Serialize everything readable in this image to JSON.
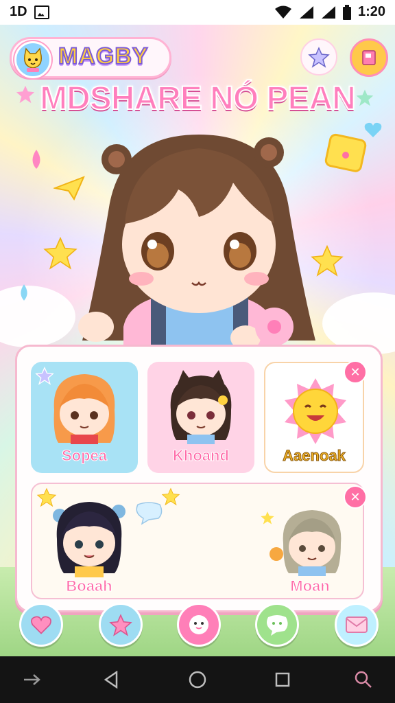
{
  "status_bar": {
    "left_text": "1D",
    "time": "1:20"
  },
  "header": {
    "brand_name": "MAGBY",
    "title": "MDSHARE NÓ PEAN",
    "buttons": [
      {
        "name": "favorites-button",
        "icon": "star-icon"
      },
      {
        "name": "notebook-button",
        "icon": "book-icon"
      }
    ]
  },
  "cards": [
    {
      "name": "Sopea",
      "bg": "#a8e2f5",
      "label_color": "#ff6aa8"
    },
    {
      "name": "Khoand",
      "bg": "#ffd3e6",
      "label_color": "#ff6aa8"
    },
    {
      "name": "Aaenoak",
      "bg": "#ffffff",
      "label_color": "#f2b425"
    },
    {
      "name": "Boaah",
      "bg": "#fff6e4",
      "label_color": "#ff6aa8"
    },
    {
      "name": "Moan",
      "bg": "#fff6e4",
      "label_color": "#ff6aa8"
    }
  ],
  "bottom_nav": [
    {
      "icon": "heart-icon",
      "color": "#9edcf2"
    },
    {
      "icon": "star-icon",
      "color": "#9edcf2"
    },
    {
      "icon": "face-icon",
      "color": "#ff7fb8"
    },
    {
      "icon": "chat-bubble-icon",
      "color": "#9fe28c"
    },
    {
      "icon": "mail-icon",
      "color": "#bff0ff"
    }
  ],
  "system_nav": [
    "back-arrow-icon",
    "back-triangle-icon",
    "home-circle-icon",
    "recents-square-icon",
    "search-icon"
  ],
  "colors": {
    "accent_pink": "#ff7fbd",
    "panel_border": "#f6b9cf"
  }
}
